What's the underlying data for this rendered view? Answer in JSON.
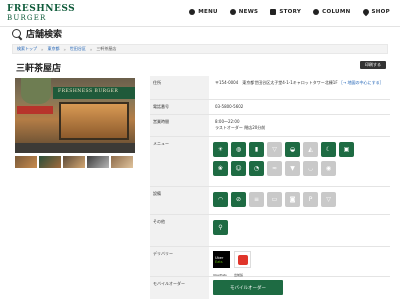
{
  "header": {
    "logo_line1": "FRESHNESS",
    "logo_line2": "BURGER",
    "nav": [
      "MENU",
      "NEWS",
      "STORY",
      "COLUMN",
      "SHOP"
    ]
  },
  "page_title": "店舗検索",
  "breadcrumb": [
    "検索トップ",
    "東京都",
    "世田谷区",
    "三軒茶屋店"
  ],
  "store": {
    "name": "三軒茶屋店",
    "print_label": "印刷する"
  },
  "info": {
    "address_label": "住所",
    "address_value": "〒154-0004　東京都世田谷区太子堂4-1-1キャロットタワー北棟1F",
    "address_link": "［→ 地図の中心にする］",
    "phone_label": "電話番号",
    "phone_value": "03-5800-5602",
    "hours_label": "営業時間",
    "hours_line1": "8:00～22:00",
    "hours_line2": "ラストオーダー 閉店20分前",
    "menu_label": "メニュー",
    "facilities_label": "設備",
    "other_label": "その他",
    "delivery_label": "デリバリー",
    "delivery_uber_line1": "Uber",
    "delivery_uber_line2": "Eats",
    "delivery_uber_caption": "UberEats",
    "delivery_demae_caption": "出前館",
    "mobile_label": "モバイルオーダー",
    "mobile_button": "モバイルオーダー"
  },
  "menu_icons": [
    {
      "icon": "morning-icon",
      "state": "on"
    },
    {
      "icon": "lunch-icon",
      "state": "on"
    },
    {
      "icon": "beer-icon",
      "state": "on"
    },
    {
      "icon": "wine-icon",
      "state": "off"
    },
    {
      "icon": "coffee-icon",
      "state": "on"
    },
    {
      "icon": "cake-icon",
      "state": "off"
    },
    {
      "icon": "dinner-icon",
      "state": "on"
    },
    {
      "icon": "takeout-icon",
      "state": "on"
    },
    {
      "icon": "salad-icon",
      "state": "on"
    },
    {
      "icon": "kids-icon",
      "state": "on"
    },
    {
      "icon": "dessert-icon",
      "state": "on"
    },
    {
      "icon": "pasta-icon",
      "state": "off"
    },
    {
      "icon": "soft-serve-icon",
      "state": "off"
    },
    {
      "icon": "soup-icon",
      "state": "off"
    },
    {
      "icon": "rice-icon",
      "state": "off"
    }
  ],
  "facility_icons": [
    {
      "icon": "wifi-icon",
      "state": "on"
    },
    {
      "icon": "no-smoking-icon",
      "state": "on"
    },
    {
      "icon": "smoking-room-icon",
      "state": "off"
    },
    {
      "icon": "power-outlet-icon",
      "state": "off"
    },
    {
      "icon": "cup-icon",
      "state": "off"
    },
    {
      "icon": "parking-icon",
      "state": "off"
    },
    {
      "icon": "drive-thru-icon",
      "state": "off"
    }
  ],
  "other_icons": [
    {
      "icon": "search-person-icon",
      "state": "on"
    }
  ],
  "colors": {
    "brand_green": "#1e6b43",
    "logo_green": "#0f5b3a",
    "disabled_gray": "#c9c9c9"
  }
}
